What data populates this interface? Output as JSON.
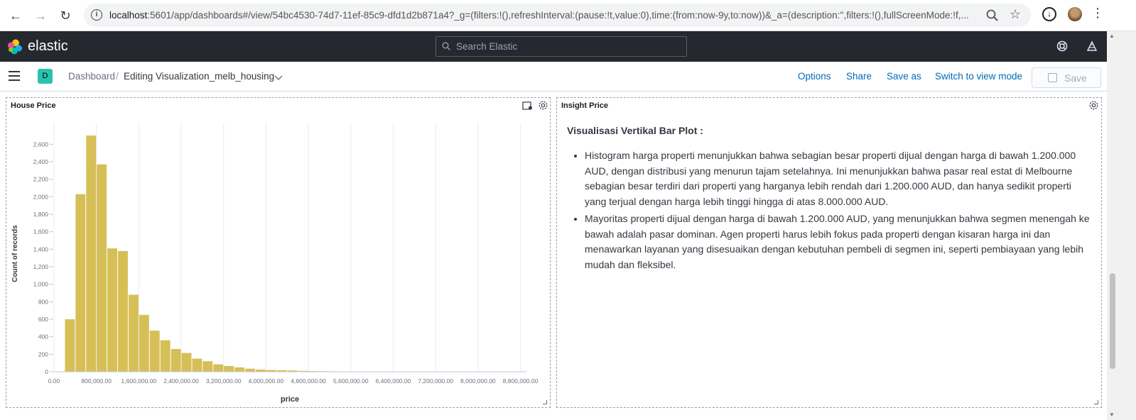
{
  "browser": {
    "url_host": "localhost",
    "url_rest": ":5601/app/dashboards#/view/54bc4530-74d7-11ef-85c9-dfd1d2b871a4?_g=(filters:!(),refreshInterval:(pause:!t,value:0),time:(from:now-9y,to:now))&_a=(description:'',filters:!(),fullScreenMode:!f,..."
  },
  "header": {
    "logo_text": "elastic",
    "search_placeholder": "Search Elastic"
  },
  "topnav": {
    "space_initial": "D",
    "breadcrumb_root": "Dashboard",
    "breadcrumb_separator": "/",
    "breadcrumb_current": "Editing Visualization_melb_housing",
    "options": "Options",
    "share": "Share",
    "save_as": "Save as",
    "switch_mode": "Switch to view mode",
    "save": "Save"
  },
  "panels": {
    "left_title": "House Price",
    "right_title": "Insight Price"
  },
  "insight": {
    "heading": "Visualisasi Vertikal Bar Plot :",
    "bullets": [
      "Histogram harga properti menunjukkan bahwa sebagian besar properti dijual dengan harga di bawah 1.200.000 AUD, dengan distribusi yang menurun tajam setelahnya. Ini menunjukkan bahwa pasar real estat di Melbourne sebagian besar terdiri dari properti yang harganya lebih rendah dari 1.200.000 AUD, dan hanya sedikit properti yang terjual dengan harga lebih tinggi hingga di atas 8.000.000 AUD.",
      "Mayoritas properti dijual dengan harga di bawah 1.200.000 AUD, yang menunjukkan bahwa segmen menengah ke bawah adalah pasar dominan. Agen properti harus lebih fokus pada properti dengan kisaran harga ini dan menawarkan layanan yang disesuaikan dengan kebutuhan pembeli di segmen ini, seperti pembiayaan yang lebih mudah dan fleksibel."
    ]
  },
  "colors": {
    "bar": "#d6bf57",
    "accent": "#006bb8",
    "header_bg": "#25282f"
  },
  "chart_data": {
    "type": "bar",
    "xlabel": "price",
    "ylabel": "Count of records",
    "bin_width": 200000,
    "x": [
      200000,
      400000,
      600000,
      800000,
      1000000,
      1200000,
      1400000,
      1600000,
      1800000,
      2000000,
      2200000,
      2400000,
      2600000,
      2800000,
      3000000,
      3200000,
      3400000,
      3600000,
      3800000,
      4000000,
      4200000,
      4400000,
      4600000,
      4800000,
      5000000,
      5200000,
      5400000,
      5600000,
      5800000,
      6000000,
      6200000,
      6400000
    ],
    "values": [
      600,
      2030,
      2700,
      2370,
      1410,
      1380,
      880,
      650,
      470,
      360,
      260,
      215,
      150,
      120,
      85,
      65,
      50,
      35,
      25,
      20,
      18,
      15,
      10,
      8,
      6,
      5,
      4,
      3,
      2,
      2,
      1,
      1
    ],
    "ylim": [
      0,
      2700
    ],
    "yticks": [
      0,
      200,
      400,
      600,
      800,
      1000,
      1200,
      1400,
      1600,
      1800,
      2000,
      2200,
      2400,
      2600
    ],
    "ytick_labels": [
      "0",
      "200",
      "400",
      "600",
      "800",
      "1,000",
      "1,200",
      "1,400",
      "1,600",
      "1,800",
      "2,000",
      "2,200",
      "2,400",
      "2,600"
    ],
    "xlim": [
      0,
      8900000
    ],
    "xticks": [
      0,
      800000,
      1600000,
      2400000,
      3200000,
      4000000,
      4800000,
      5600000,
      6400000,
      7200000,
      8000000,
      8800000
    ],
    "xtick_labels": [
      "0.00",
      "800,000.00",
      "1,600,000.00",
      "2,400,000.00",
      "3,200,000.00",
      "4,000,000.00",
      "4,800,000.00",
      "5,600,000.00",
      "6,400,000.00",
      "7,200,000.00",
      "8,000,000.00",
      "8,800,000.00"
    ],
    "grid": "vertical"
  }
}
